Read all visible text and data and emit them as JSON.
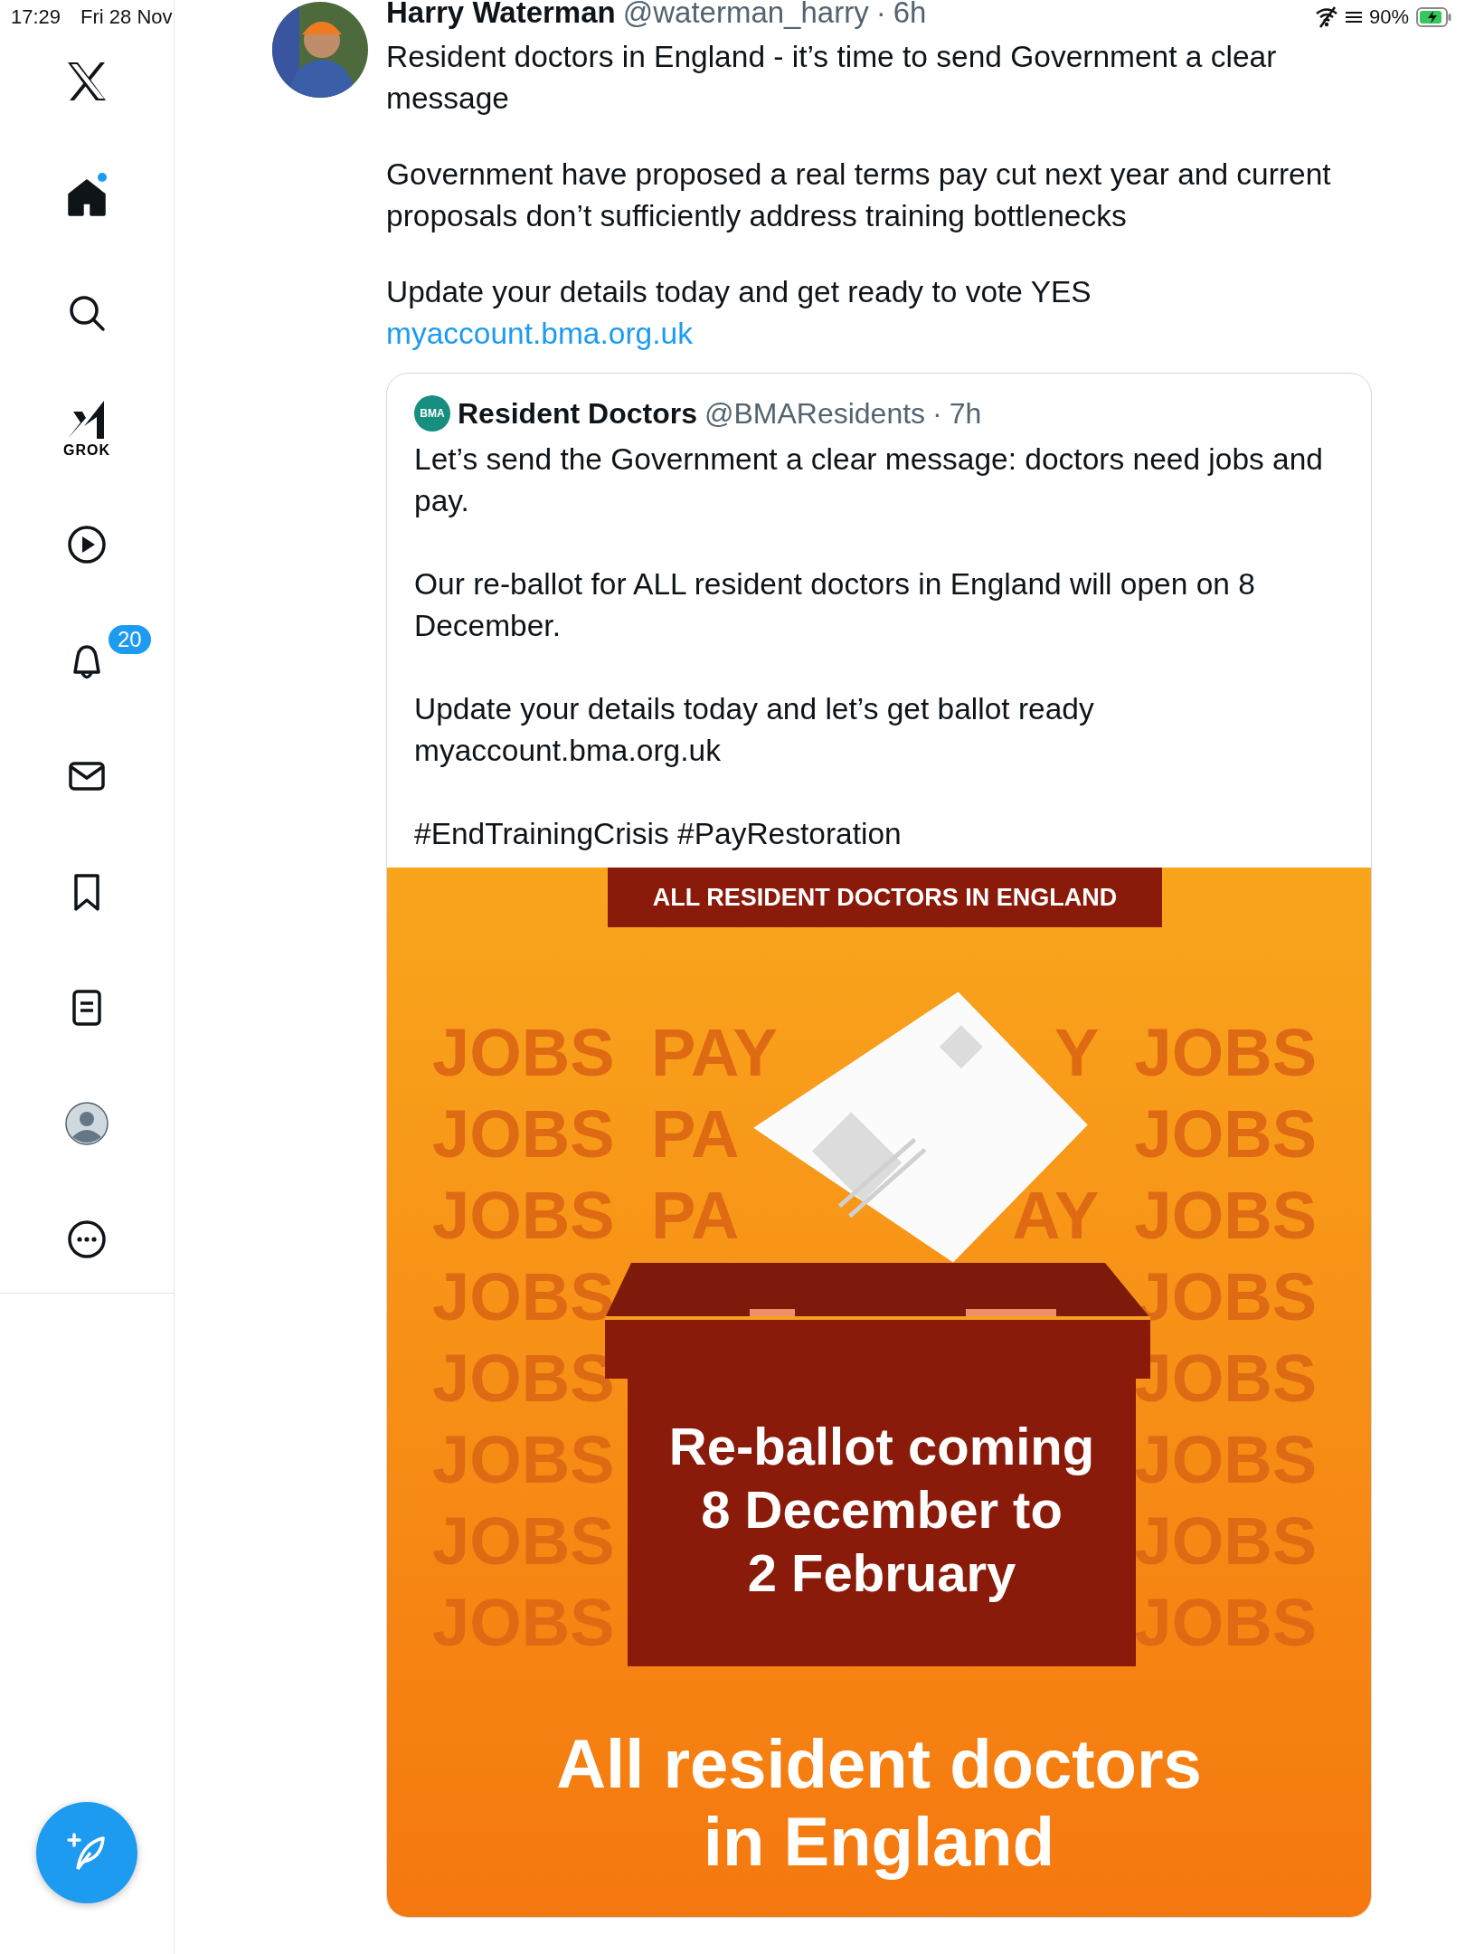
{
  "status_bar": {
    "time": "17:29",
    "date": "Fri 28 Nov",
    "battery": "90%"
  },
  "sidebar": {
    "items": [
      {
        "kind": "logo",
        "selected": false,
        "unread": false
      },
      {
        "kind": "home",
        "selected": true,
        "unread": true
      },
      {
        "kind": "search",
        "selected": false,
        "unread": false
      },
      {
        "kind": "grok",
        "selected": false,
        "unread": false,
        "label": "GROK"
      },
      {
        "kind": "video",
        "selected": false,
        "unread": false
      },
      {
        "kind": "notifications",
        "selected": false,
        "unread": false,
        "badge": "20"
      },
      {
        "kind": "messages",
        "selected": false,
        "unread": false
      },
      {
        "kind": "bookmarks",
        "selected": false,
        "unread": false
      },
      {
        "kind": "lists",
        "selected": false,
        "unread": false
      },
      {
        "kind": "profile",
        "selected": false,
        "unread": false
      },
      {
        "kind": "more",
        "selected": false,
        "unread": false
      }
    ]
  },
  "tweet": {
    "author": "Harry Waterman",
    "handle": "@waterman_harry",
    "separator": "·",
    "time": "6h",
    "paragraphs": [
      "Resident doctors in England - it’s time to send Government a clear message",
      "Government have proposed a real terms pay cut next year and current proposals don’t sufficiently address training bottlenecks",
      "Update your details today and get ready to vote YES"
    ],
    "link": "myaccount.bma.org.uk",
    "quote": {
      "avatar_label": "BMA",
      "author": "Resident Doctors",
      "handle": "@BMAResidents",
      "separator": "·",
      "time": "7h",
      "paragraphs": [
        "Let’s send the Government a clear message: doctors need jobs and pay.",
        "Our re-ballot for ALL resident doctors in England will open on 8 December.",
        "Update your details today and let’s get ballot ready\nmyaccount.bma.org.uk",
        "#EndTrainingCrisis #PayRestoration"
      ],
      "graphic": {
        "banner": "ALL RESIDENT DOCTORS IN ENGLAND",
        "rows": [
          {
            "left": "JOBS PAY",
            "right": "Y JOBS"
          },
          {
            "left": "JOBS PA",
            "right": "JOBS"
          },
          {
            "left": "JOBS PA",
            "right": "AY JOBS"
          },
          {
            "left": "JOBS",
            "right": "JOBS"
          },
          {
            "left": "JOBS",
            "right": "JOBS"
          },
          {
            "left": "JOBS",
            "right": "JOBS"
          },
          {
            "left": "JOBS",
            "right": "JOBS"
          },
          {
            "left": "JOBS",
            "right": "JOBS"
          }
        ],
        "box_text": [
          "Re-ballot coming",
          "8 December to",
          "2 February"
        ],
        "footer": [
          "All resident doctors",
          "in England"
        ]
      }
    }
  }
}
